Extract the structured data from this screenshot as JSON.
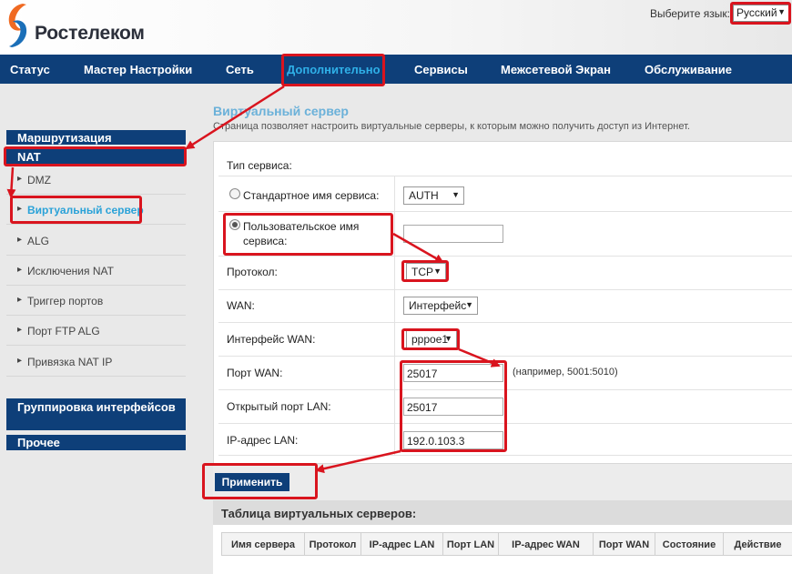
{
  "header": {
    "brand": "Ростелеком",
    "language_label": "Выберите язык:",
    "language_value": "Русский"
  },
  "nav": {
    "items": [
      "Статус",
      "Мастер Настройки",
      "Сеть",
      "Дополнительно",
      "Сервисы",
      "Межсетевой Экран",
      "Обслуживание"
    ]
  },
  "sidebar": {
    "routing": "Маршрутизация",
    "nat": "NAT",
    "items": [
      "DMZ",
      "Виртуальный сервер",
      "ALG",
      "Исключения NAT",
      "Триггер портов",
      "Порт FTP ALG",
      "Привязка NAT IP"
    ],
    "grouping": "Группировка интерфейсов",
    "other": "Прочее"
  },
  "page": {
    "title": "Виртуальный сервер",
    "description": "Страница позволяет настроить виртуальные серверы, к которым можно получить доступ из Интернет."
  },
  "form": {
    "service_type_label": "Тип сервиса:",
    "standard_service_label": "Стандартное имя сервиса:",
    "standard_service_value": "AUTH",
    "custom_service_label_1": "Пользовательское имя",
    "custom_service_label_2": "сервиса:",
    "custom_service_value": "",
    "protocol_label": "Протокол:",
    "protocol_value": "TCP",
    "wan_label": "WAN:",
    "wan_value": "Интерфейс",
    "wan_interface_label": "Интерфейс WAN:",
    "wan_interface_value": "pppoe1",
    "wan_port_label": "Порт WAN:",
    "wan_port_value": "25017",
    "wan_port_hint": "(например, 5001:5010)",
    "lan_port_label": "Открытый порт LAN:",
    "lan_port_value": "25017",
    "lan_ip_label": "IP-адрес LAN:",
    "lan_ip_value": "192.0.103.3",
    "apply_label": "Применить"
  },
  "table": {
    "title": "Таблица виртуальных серверов:",
    "columns": [
      "Имя сервера",
      "Протокол",
      "IP-адрес LAN",
      "Порт LAN",
      "IP-адрес WAN",
      "Порт WAN",
      "Состояние",
      "Действие"
    ]
  },
  "colors": {
    "nav_bg": "#0e3f79",
    "active_nav": "#2fb0e8",
    "annotation": "#d9141e",
    "title": "#6bb1d9"
  }
}
